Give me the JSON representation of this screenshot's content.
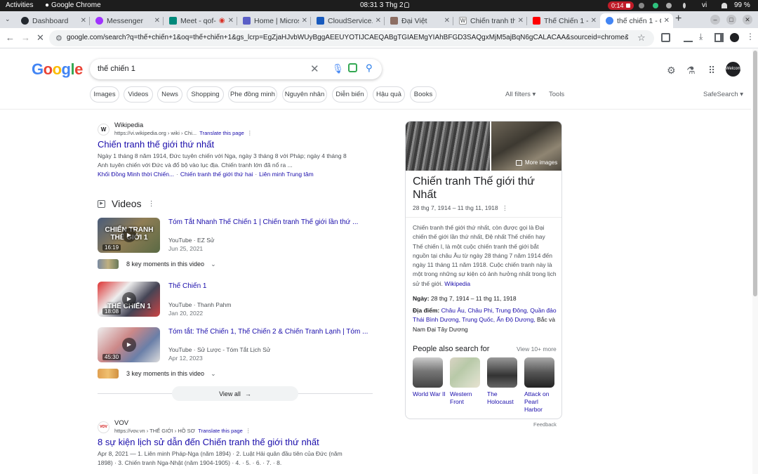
{
  "os": {
    "activities": "Activities",
    "app_name": "Google Chrome",
    "clock": "08:31  3 Thg 2",
    "recording": "0:14",
    "lang": "vi",
    "battery": "99 %"
  },
  "tabs": [
    {
      "title": "Dashboard",
      "color": "#24292f"
    },
    {
      "title": "Messenger",
      "color": "#a033ff"
    },
    {
      "title": "Meet - qof-",
      "color": "#00897b"
    },
    {
      "title": "Home | Micros",
      "color": "#5b5fc7"
    },
    {
      "title": "CloudService.c",
      "color": "#185abd"
    },
    {
      "title": "Đại Việt",
      "color": "#8d6e63"
    },
    {
      "title": "Chiến tranh th",
      "color": "#000000"
    },
    {
      "title": "Thế Chiến 1 -",
      "color": "#ff0000"
    },
    {
      "title": "thế chiến 1 - C",
      "color": "#4285f4"
    }
  ],
  "address": {
    "url": "google.com/search?q=thế+chiến+1&oq=thế+chiến+1&gs_lcrp=EgZjaHJvbWUyBggAEEUYOTIJCAEQABgTGIAEMgYIAhBFGD3SAQgxMjM5ajBqN6gCALACAA&sourceid=chrome&ie=UTF-8"
  },
  "google": {
    "logo": [
      "G",
      "o",
      "o",
      "g",
      "l",
      "e"
    ],
    "query": "thế chiến 1",
    "avatar_text": "Welcome"
  },
  "chips": [
    "Images",
    "Videos",
    "News",
    "Shopping",
    "Phe đồng minh",
    "Nguyên nhân",
    "Diễn biến",
    "Hậu quả",
    "Books"
  ],
  "filters": {
    "all": "All filters ▾",
    "tools": "Tools",
    "safe": "SafeSearch ▾"
  },
  "result1": {
    "site": "Wikipedia",
    "icon": "W",
    "url": "https://vi.wikipedia.org › wiki › Chi...",
    "translate": "Translate this page",
    "title": "Chiến tranh thế giới thứ nhất",
    "snippet_1": "Ngày 1 tháng 8 năm 1914, Đức tuyên chiến với Nga, ngày 3 tháng 8 với Pháp; ngày 4 tháng 8",
    "snippet_2": "Anh tuyên chiến với Đức và đổ bộ vào lục địa. Chiến tranh lớn đã nổ ra ...",
    "links": [
      "Khối Đồng Minh thời Chiến...",
      "Chiến tranh thế giới thứ hai",
      "Liên minh Trung tâm"
    ]
  },
  "videos": {
    "heading": "Videos",
    "items": [
      {
        "title": "Tóm Tắt Nhanh Thế Chiến 1 | Chiến tranh Thế giới lần thứ ...",
        "source": "YouTube",
        "channel": "· EZ Sử",
        "date": "Jun 25, 2021",
        "duration": "16:19",
        "caption": "CHIẾN TRANH THẾ GIỚI 1",
        "moments": "8 key moments in this video"
      },
      {
        "title": "Thế Chiến 1",
        "source": "YouTube",
        "channel": "· Thanh Pahm",
        "date": "Jan 20, 2022",
        "duration": "18:08",
        "caption": "THẾ CHIẾN 1",
        "moments": ""
      },
      {
        "title": "Tóm tắt: Thế Chiến 1, Thế Chiến 2 & Chiến Tranh Lạnh | Tóm ...",
        "source": "YouTube",
        "channel": "· Sử Lược - Tóm Tắt Lịch Sử",
        "date": "Apr 12, 2023",
        "duration": "45:30",
        "caption": "",
        "moments": "3 key moments in this video"
      }
    ],
    "view_all": "View all"
  },
  "result2": {
    "site": "VOV",
    "icon": "VOV",
    "url": "https://vov.vn › THẾ GIỚI › HỒ SƠ",
    "translate": "Translate this page",
    "title": "8 sự kiện lịch sử dẫn đến Chiến tranh thế giới thứ nhất",
    "snippet_1": "Apr 8, 2021 — 1. Liên minh Pháp-Nga (năm 1894) · 2. Luật Hải quân đầu tiên của Đức (năm",
    "snippet_2": "1898) · 3. Chiến tranh Nga-Nhật (năm 1904-1905) · 4. · 5. · 6. · 7. · 8."
  },
  "knowledge_panel": {
    "more_images": "More images",
    "title": "Chiến tranh Thế giới thứ Nhất",
    "dates": "28 thg 7, 1914 – 11 thg 11, 1918",
    "description": "Chiến tranh thế giới thứ nhất, còn được gọi là Đại chiến thế giới lần thứ nhất, Đệ nhất Thế chiến hay Thế chiến I, là một cuộc chiến tranh thế giới bắt nguồn tại châu Âu từ ngày 28 tháng 7 năm 1914 đến ngày 11 tháng 11 năm 1918. Cuộc chiến tranh này là một trong những sự kiện có ảnh hưởng nhất trong lịch sử thế giới.",
    "source": "Wikipedia",
    "date_label": "Ngày:",
    "date_value": "28 thg 7, 1914 – 11 thg 11, 1918",
    "place_label": "Địa điểm:",
    "place_links": "Châu Âu, Châu Phi, Trung Đông, Quần đảo Thái Bình Dương, Trung Quốc, Ấn Độ Dương,",
    "place_rest": "Bắc và Nam Đại Tây Dương",
    "pas_heading": "People also search for",
    "pas_more": "View 10+ more",
    "pas": [
      "World War II",
      "Western Front",
      "The Holocaust",
      "Attack on Pearl Harbor"
    ],
    "feedback": "Feedback"
  }
}
